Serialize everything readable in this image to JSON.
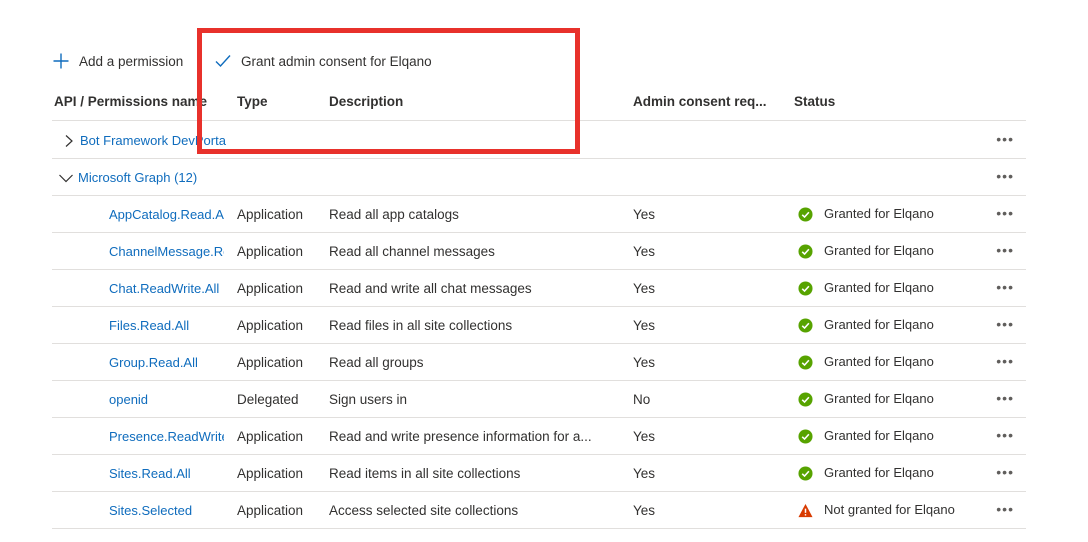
{
  "toolbar": {
    "add_label": "Add a permission",
    "grant_label": "Grant admin consent for Elqano"
  },
  "columns": {
    "name": "API / Permissions name",
    "type": "Type",
    "description": "Description",
    "admin_consent": "Admin consent req...",
    "status": "Status"
  },
  "groups": [
    {
      "label": "Bot Framework DevPortal",
      "expanded": false
    },
    {
      "label": "Microsoft Graph (12)",
      "expanded": true
    }
  ],
  "permissions": [
    {
      "name": "AppCatalog.Read.All",
      "type": "Application",
      "description": "Read all app catalogs",
      "admin": "Yes",
      "status": "Granted for Elqano",
      "granted": true
    },
    {
      "name": "ChannelMessage.Read.All",
      "type": "Application",
      "description": "Read all channel messages",
      "admin": "Yes",
      "status": "Granted for Elqano",
      "granted": true
    },
    {
      "name": "Chat.ReadWrite.All",
      "type": "Application",
      "description": "Read and write all chat messages",
      "admin": "Yes",
      "status": "Granted for Elqano",
      "granted": true
    },
    {
      "name": "Files.Read.All",
      "type": "Application",
      "description": "Read files in all site collections",
      "admin": "Yes",
      "status": "Granted for Elqano",
      "granted": true
    },
    {
      "name": "Group.Read.All",
      "type": "Application",
      "description": "Read all groups",
      "admin": "Yes",
      "status": "Granted for Elqano",
      "granted": true
    },
    {
      "name": "openid",
      "type": "Delegated",
      "description": "Sign users in",
      "admin": "No",
      "status": "Granted for Elqano",
      "granted": true
    },
    {
      "name": "Presence.ReadWrite.All",
      "type": "Application",
      "description": "Read and write presence information for a...",
      "admin": "Yes",
      "status": "Granted for Elqano",
      "granted": true
    },
    {
      "name": "Sites.Read.All",
      "type": "Application",
      "description": "Read items in all site collections",
      "admin": "Yes",
      "status": "Granted for Elqano",
      "granted": true
    },
    {
      "name": "Sites.Selected",
      "type": "Application",
      "description": "Access selected site collections",
      "admin": "Yes",
      "status": "Not granted for Elqano",
      "granted": false
    }
  ],
  "more_label": "•••",
  "colors": {
    "link": "#0f6cbd",
    "success": "#57a300",
    "warning": "#d83b01",
    "highlight": "#e8312b"
  }
}
